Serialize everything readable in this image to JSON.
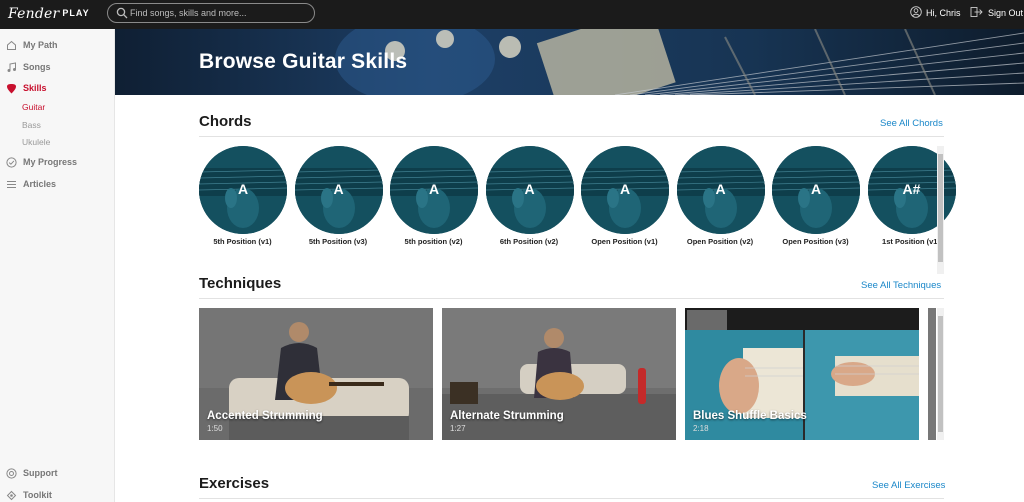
{
  "topbar": {
    "logo_script": "Fender",
    "logo_play": "PLAY",
    "search_placeholder": "Find songs, skills and more...",
    "greeting": "Hi, Chris",
    "signout": "Sign Out"
  },
  "sidebar": {
    "items": [
      {
        "label": "My Path",
        "icon": "path-icon"
      },
      {
        "label": "Songs",
        "icon": "music-note-icon"
      },
      {
        "label": "Skills",
        "icon": "pick-icon"
      },
      {
        "label": "My Progress",
        "icon": "check-circle-icon"
      },
      {
        "label": "Articles",
        "icon": "list-icon"
      }
    ],
    "sub_items": [
      "Guitar",
      "Bass",
      "Ukulele"
    ],
    "footer": [
      {
        "label": "Support",
        "icon": "lifebuoy-icon"
      },
      {
        "label": "Toolkit",
        "icon": "toolkit-icon"
      }
    ]
  },
  "hero": {
    "title": "Browse Guitar Skills"
  },
  "chords": {
    "title": "Chords",
    "see_all": "See All Chords",
    "items": [
      {
        "chord": "A",
        "label": "5th Position (v1)"
      },
      {
        "chord": "A",
        "label": "5th Position (v3)"
      },
      {
        "chord": "A",
        "label": "5th position (v2)"
      },
      {
        "chord": "A",
        "label": "6th Position (v2)"
      },
      {
        "chord": "A",
        "label": "Open Position (v1)"
      },
      {
        "chord": "A",
        "label": "Open Position (v2)"
      },
      {
        "chord": "A",
        "label": "Open Position (v3)"
      },
      {
        "chord": "A#",
        "label": "1st Position (v1)"
      }
    ]
  },
  "techniques": {
    "title": "Techniques",
    "see_all": "See All Techniques",
    "items": [
      {
        "title": "Accented Strumming",
        "duration": "1:50"
      },
      {
        "title": "Alternate Strumming",
        "duration": "1:27"
      },
      {
        "title": "Blues Shuffle Basics",
        "duration": "2:18"
      }
    ]
  },
  "exercises": {
    "title": "Exercises",
    "see_all": "See All Exercises"
  },
  "colors": {
    "accent_red": "#c8102e",
    "link_blue": "#1a87c9",
    "topbar": "#1b1b1b",
    "chord_teal": "#14505f"
  }
}
